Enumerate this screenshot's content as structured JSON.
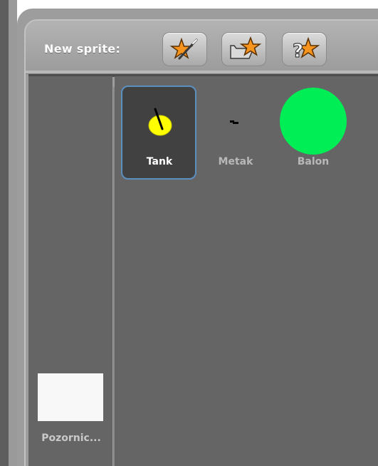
{
  "toolbar": {
    "label": "New sprite:",
    "buttons": [
      {
        "icon": "paint-new-sprite-icon"
      },
      {
        "icon": "choose-sprite-from-file-icon"
      },
      {
        "icon": "surprise-sprite-icon"
      }
    ]
  },
  "sprites": [
    {
      "name": "Tank",
      "selected": true,
      "color": "#ffff00"
    },
    {
      "name": "Metak",
      "selected": false,
      "color": "#000000"
    },
    {
      "name": "Balon",
      "selected": false,
      "color": "#00ee55"
    }
  ],
  "stage": {
    "label": "Pozornic..."
  },
  "colors": {
    "panel": "#9d9d9d",
    "sprite_area": "#656565",
    "selection_border": "#5a8fc0",
    "selected_bg": "#414141",
    "stage_thumb": "#f8f8f8"
  }
}
